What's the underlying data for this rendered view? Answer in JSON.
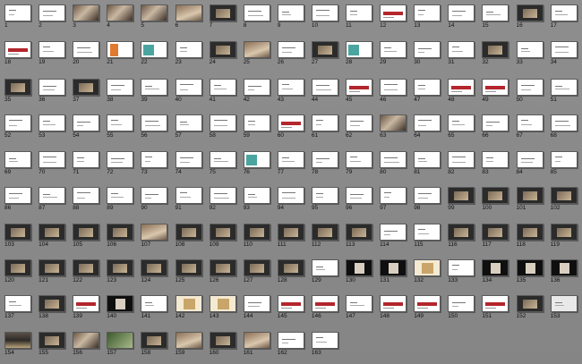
{
  "slides": [
    {
      "n": "1",
      "style": "white"
    },
    {
      "n": "2",
      "style": "white"
    },
    {
      "n": "3",
      "style": "photo"
    },
    {
      "n": "4",
      "style": "photo"
    },
    {
      "n": "5",
      "style": "photo"
    },
    {
      "n": "6",
      "style": "warm"
    },
    {
      "n": "7",
      "style": "dark"
    },
    {
      "n": "8",
      "style": "white"
    },
    {
      "n": "9",
      "style": "white"
    },
    {
      "n": "10",
      "style": "white"
    },
    {
      "n": "11",
      "style": "white"
    },
    {
      "n": "12",
      "style": "red"
    },
    {
      "n": "13",
      "style": "white"
    },
    {
      "n": "14",
      "style": "white"
    },
    {
      "n": "15",
      "style": "white"
    },
    {
      "n": "16",
      "style": "dark"
    },
    {
      "n": "17",
      "style": "white"
    },
    {
      "n": "18",
      "style": "red"
    },
    {
      "n": "19",
      "style": "white"
    },
    {
      "n": "20",
      "style": "white"
    },
    {
      "n": "21",
      "style": "orange"
    },
    {
      "n": "22",
      "style": "teal"
    },
    {
      "n": "23",
      "style": "white"
    },
    {
      "n": "24",
      "style": "dark"
    },
    {
      "n": "25",
      "style": "warm"
    },
    {
      "n": "26",
      "style": "white"
    },
    {
      "n": "27",
      "style": "dark"
    },
    {
      "n": "28",
      "style": "teal"
    },
    {
      "n": "29",
      "style": "white"
    },
    {
      "n": "30",
      "style": "white"
    },
    {
      "n": "31",
      "style": "white"
    },
    {
      "n": "32",
      "style": "dark"
    },
    {
      "n": "33",
      "style": "white"
    },
    {
      "n": "34",
      "style": "white"
    },
    {
      "n": "35",
      "style": "dark"
    },
    {
      "n": "36",
      "style": "white"
    },
    {
      "n": "37",
      "style": "dark"
    },
    {
      "n": "38",
      "style": "white"
    },
    {
      "n": "39",
      "style": "white"
    },
    {
      "n": "40",
      "style": "white"
    },
    {
      "n": "41",
      "style": "white"
    },
    {
      "n": "42",
      "style": "white"
    },
    {
      "n": "43",
      "style": "white"
    },
    {
      "n": "44",
      "style": "white"
    },
    {
      "n": "45",
      "style": "red"
    },
    {
      "n": "46",
      "style": "white"
    },
    {
      "n": "47",
      "style": "white"
    },
    {
      "n": "48",
      "style": "red"
    },
    {
      "n": "49",
      "style": "red"
    },
    {
      "n": "50",
      "style": "white"
    },
    {
      "n": "51",
      "style": "white"
    },
    {
      "n": "52",
      "style": "white"
    },
    {
      "n": "53",
      "style": "white"
    },
    {
      "n": "54",
      "style": "white"
    },
    {
      "n": "55",
      "style": "white"
    },
    {
      "n": "56",
      "style": "white"
    },
    {
      "n": "57",
      "style": "white"
    },
    {
      "n": "58",
      "style": "white"
    },
    {
      "n": "59",
      "style": "white"
    },
    {
      "n": "60",
      "style": "red"
    },
    {
      "n": "61",
      "style": "white"
    },
    {
      "n": "62",
      "style": "white"
    },
    {
      "n": "63",
      "style": "photo"
    },
    {
      "n": "64",
      "style": "white"
    },
    {
      "n": "65",
      "style": "white"
    },
    {
      "n": "66",
      "style": "white"
    },
    {
      "n": "67",
      "style": "white"
    },
    {
      "n": "68",
      "style": "white"
    },
    {
      "n": "69",
      "style": "white"
    },
    {
      "n": "70",
      "style": "white"
    },
    {
      "n": "71",
      "style": "white"
    },
    {
      "n": "72",
      "style": "white"
    },
    {
      "n": "73",
      "style": "white"
    },
    {
      "n": "74",
      "style": "white"
    },
    {
      "n": "75",
      "style": "white"
    },
    {
      "n": "76",
      "style": "teal"
    },
    {
      "n": "77",
      "style": "white"
    },
    {
      "n": "78",
      "style": "white"
    },
    {
      "n": "79",
      "style": "white"
    },
    {
      "n": "80",
      "style": "white"
    },
    {
      "n": "81",
      "style": "white"
    },
    {
      "n": "82",
      "style": "white"
    },
    {
      "n": "83",
      "style": "white"
    },
    {
      "n": "84",
      "style": "white"
    },
    {
      "n": "85",
      "style": "white"
    },
    {
      "n": "86",
      "style": "white"
    },
    {
      "n": "87",
      "style": "white"
    },
    {
      "n": "88",
      "style": "white"
    },
    {
      "n": "89",
      "style": "white"
    },
    {
      "n": "90",
      "style": "white"
    },
    {
      "n": "91",
      "style": "white"
    },
    {
      "n": "92",
      "style": "white"
    },
    {
      "n": "93",
      "style": "white"
    },
    {
      "n": "94",
      "style": "white"
    },
    {
      "n": "95",
      "style": "white"
    },
    {
      "n": "96",
      "style": "white"
    },
    {
      "n": "97",
      "style": "white"
    },
    {
      "n": "98",
      "style": "white"
    },
    {
      "n": "99",
      "style": "dark"
    },
    {
      "n": "100",
      "style": "dark"
    },
    {
      "n": "101",
      "style": "dark"
    },
    {
      "n": "102",
      "style": "dark"
    },
    {
      "n": "103",
      "style": "dark"
    },
    {
      "n": "104",
      "style": "dark"
    },
    {
      "n": "105",
      "style": "dark"
    },
    {
      "n": "106",
      "style": "dark"
    },
    {
      "n": "107",
      "style": "warm"
    },
    {
      "n": "108",
      "style": "dark"
    },
    {
      "n": "109",
      "style": "dark"
    },
    {
      "n": "110",
      "style": "dark"
    },
    {
      "n": "111",
      "style": "dark"
    },
    {
      "n": "112",
      "style": "dark"
    },
    {
      "n": "113",
      "style": "dark"
    },
    {
      "n": "114",
      "style": "white"
    },
    {
      "n": "115",
      "style": "white"
    },
    {
      "n": "116",
      "style": "dark"
    },
    {
      "n": "117",
      "style": "dark"
    },
    {
      "n": "118",
      "style": "dark"
    },
    {
      "n": "119",
      "style": "dark"
    },
    {
      "n": "120",
      "style": "dark"
    },
    {
      "n": "121",
      "style": "dark"
    },
    {
      "n": "122",
      "style": "dark"
    },
    {
      "n": "123",
      "style": "dark"
    },
    {
      "n": "124",
      "style": "dark"
    },
    {
      "n": "125",
      "style": "dark"
    },
    {
      "n": "126",
      "style": "dark"
    },
    {
      "n": "127",
      "style": "dark"
    },
    {
      "n": "128",
      "style": "dark"
    },
    {
      "n": "129",
      "style": "white"
    },
    {
      "n": "130",
      "style": "black"
    },
    {
      "n": "131",
      "style": "black"
    },
    {
      "n": "132",
      "style": "gold"
    },
    {
      "n": "133",
      "style": "white"
    },
    {
      "n": "134",
      "style": "black"
    },
    {
      "n": "135",
      "style": "black"
    },
    {
      "n": "136",
      "style": "black"
    },
    {
      "n": "137",
      "style": "white"
    },
    {
      "n": "138",
      "style": "dark"
    },
    {
      "n": "139",
      "style": "red"
    },
    {
      "n": "140",
      "style": "black"
    },
    {
      "n": "141",
      "style": "white"
    },
    {
      "n": "142",
      "style": "gold"
    },
    {
      "n": "143",
      "style": "gold"
    },
    {
      "n": "144",
      "style": "white"
    },
    {
      "n": "145",
      "style": "red"
    },
    {
      "n": "146",
      "style": "red"
    },
    {
      "n": "147",
      "style": "white"
    },
    {
      "n": "148",
      "style": "red"
    },
    {
      "n": "149",
      "style": "red"
    },
    {
      "n": "150",
      "style": "white"
    },
    {
      "n": "151",
      "style": "red"
    },
    {
      "n": "152",
      "style": "dark"
    },
    {
      "n": "153",
      "style": "gray"
    },
    {
      "n": "154",
      "style": "street"
    },
    {
      "n": "155",
      "style": "dark"
    },
    {
      "n": "156",
      "style": "photo"
    },
    {
      "n": "157",
      "style": "green"
    },
    {
      "n": "158",
      "style": "dark"
    },
    {
      "n": "159",
      "style": "warm"
    },
    {
      "n": "160",
      "style": "dark"
    },
    {
      "n": "161",
      "style": "warm"
    },
    {
      "n": "162",
      "style": "white"
    },
    {
      "n": "163",
      "style": "white"
    }
  ],
  "colors": {
    "background": "#8a8a8a",
    "accent_red": "#b3262c",
    "accent_teal": "#4aa5a0",
    "accent_orange": "#e07a2e"
  }
}
